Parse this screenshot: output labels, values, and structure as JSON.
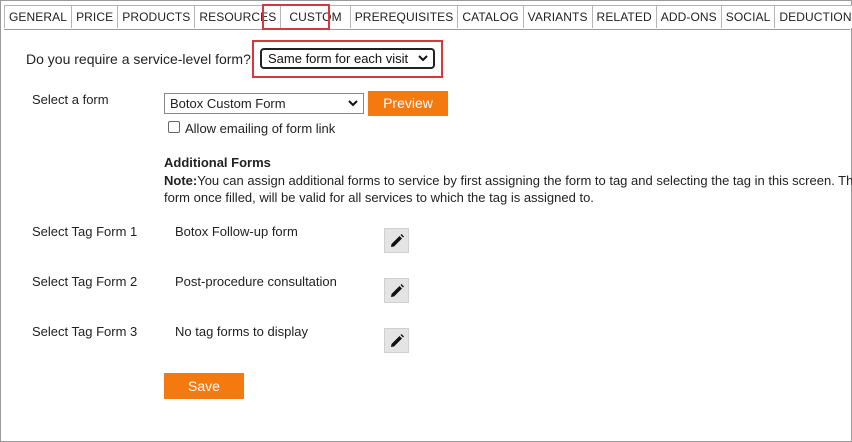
{
  "tabs": [
    {
      "label": "GENERAL",
      "active": false
    },
    {
      "label": "PRICE",
      "active": false
    },
    {
      "label": "PRODUCTS",
      "active": false
    },
    {
      "label": "RESOURCES",
      "active": false
    },
    {
      "label": "CUSTOM",
      "active": true
    },
    {
      "label": "PREREQUISITES",
      "active": false
    },
    {
      "label": "CATALOG",
      "active": false
    },
    {
      "label": "VARIANTS",
      "active": false
    },
    {
      "label": "RELATED",
      "active": false
    },
    {
      "label": "ADD-ONS",
      "active": false
    },
    {
      "label": "SOCIAL",
      "active": false
    },
    {
      "label": "DEDUCTIONS",
      "active": false
    }
  ],
  "service_form": {
    "question": "Do you require a service-level form?",
    "selected": "Same form for each visit"
  },
  "select_form": {
    "label": "Select a form",
    "selected": "Botox Custom Form",
    "preview_label": "Preview",
    "allow_email_label": "Allow emailing of form link",
    "allow_email_checked": false
  },
  "additional_forms": {
    "title": "Additional Forms",
    "note_prefix": "Note:",
    "note_line1": "You can assign additional forms to service by first assigning the form to tag and selecting the tag in this screen. The",
    "note_line2": "form once filled, will be valid for all services to which the tag is assigned to."
  },
  "tag_forms": [
    {
      "label": "Select Tag Form 1",
      "value": "Botox Follow-up form"
    },
    {
      "label": "Select Tag Form 2",
      "value": "Post-procedure consultation"
    },
    {
      "label": "Select Tag Form 3",
      "value": "No tag forms to display"
    }
  ],
  "save_label": "Save",
  "colors": {
    "accent": "#f47a10",
    "highlight": "#d9363e"
  },
  "icons": {
    "edit": "pencil-icon",
    "dropdown": "chevron-down-icon"
  }
}
